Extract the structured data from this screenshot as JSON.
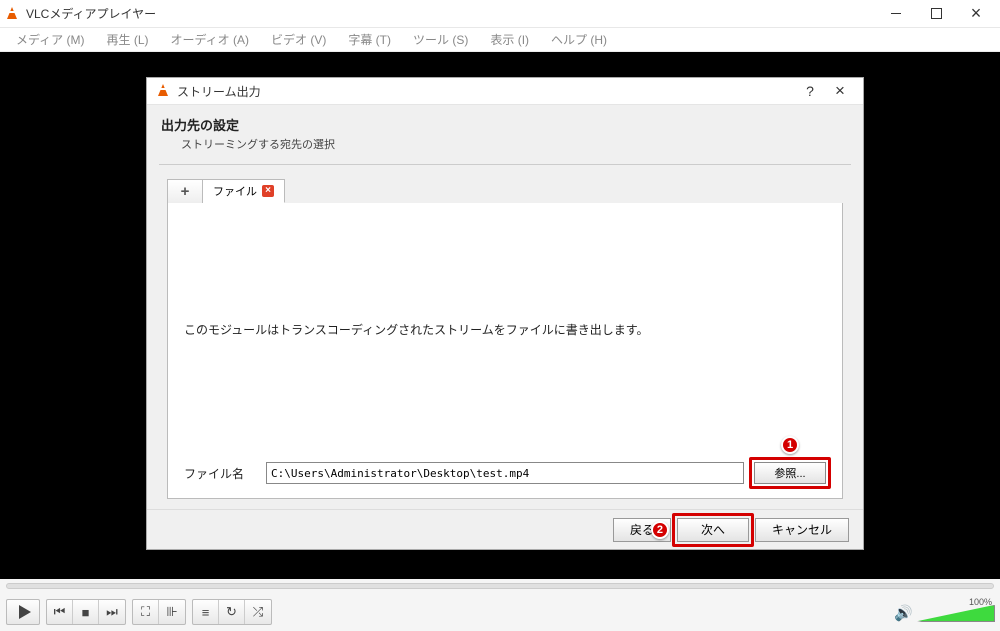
{
  "app": {
    "title": "VLCメディアプレイヤー"
  },
  "menu": {
    "media": "メディア (M)",
    "playback": "再生 (L)",
    "audio": "オーディオ (A)",
    "video": "ビデオ (V)",
    "subtitle": "字幕 (T)",
    "tools": "ツール (S)",
    "view": "表示 (I)",
    "help": "ヘルプ (H)"
  },
  "controls": {
    "volume_label": "100%"
  },
  "dialog": {
    "title": "ストリーム出力",
    "heading": "出力先の設定",
    "subheading": "ストリーミングする宛先の選択",
    "tab_label": "ファイル",
    "module_desc": "このモジュールはトランスコーディングされたストリームをファイルに書き出します。",
    "file_label": "ファイル名",
    "file_value": "C:\\Users\\Administrator\\Desktop\\test.mp4",
    "browse": "参照...",
    "back": "戻る",
    "next": "次へ",
    "cancel": "キャンセル"
  },
  "annotations": {
    "badge1": "1",
    "badge2": "2"
  }
}
